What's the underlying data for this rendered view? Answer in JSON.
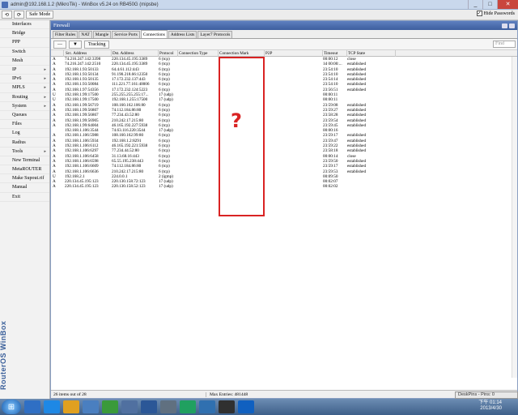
{
  "window": {
    "title": "admin@192.168.1.2 (MikroTik) - WinBox v5.24 on RB450G (mipsbe)",
    "min": "_",
    "max": "□",
    "close": "✕"
  },
  "toolbar": {
    "back": "⟲",
    "forward": "⟳",
    "safe_mode": "Safe Mode",
    "hide_passwords": "Hide Passwords",
    "hide_checked": "✓"
  },
  "sidebar": {
    "items": [
      {
        "label": "Interfaces",
        "arrow": ""
      },
      {
        "label": "Bridge",
        "arrow": ""
      },
      {
        "label": "PPP",
        "arrow": ""
      },
      {
        "label": "Switch",
        "arrow": ""
      },
      {
        "label": "Mesh",
        "arrow": ""
      },
      {
        "label": "IP",
        "arrow": "▸"
      },
      {
        "label": "IPv6",
        "arrow": "▸"
      },
      {
        "label": "MPLS",
        "arrow": "▸"
      },
      {
        "label": "Routing",
        "arrow": "▸"
      },
      {
        "label": "System",
        "arrow": "▸"
      },
      {
        "label": "Queues",
        "arrow": ""
      },
      {
        "label": "Files",
        "arrow": ""
      },
      {
        "label": "Log",
        "arrow": ""
      },
      {
        "label": "Radius",
        "arrow": ""
      },
      {
        "label": "Tools",
        "arrow": "▸"
      },
      {
        "label": "New Terminal",
        "arrow": ""
      },
      {
        "label": "MetaROUTER",
        "arrow": ""
      },
      {
        "label": "Make Supout.rif",
        "arrow": ""
      },
      {
        "label": "Manual",
        "arrow": ""
      },
      {
        "label": "Exit",
        "arrow": ""
      }
    ],
    "brand": "RouterOS WinBox"
  },
  "firewall": {
    "title": "Firewall",
    "tabs": [
      "Filter Rules",
      "NAT",
      "Mangle",
      "Service Ports",
      "Connections",
      "Address Lists",
      "Layer7 Protocols"
    ],
    "active_tab": 4,
    "minus": "—",
    "filter_icon": "▼",
    "tracking": "Tracking",
    "find_placeholder": "Find",
    "columns": [
      "",
      "Src. Address",
      "Dst. Address",
      "Protocol",
      "Connection Type",
      "Connection Mark",
      "P2P",
      "Timeout",
      "TCP State"
    ],
    "rows": [
      [
        "A",
        "74.216.247.142:3398",
        "220.134.45.195:3389",
        "6 (tcp)",
        "",
        "",
        "",
        "00:00:12",
        "close"
      ],
      [
        "A",
        "74.216.247.142:2510",
        "220.134.45.195:3389",
        "6 (tcp)",
        "",
        "",
        "",
        "1d 00:00:...",
        "established"
      ],
      [
        "A",
        "192.168.1.93:50133",
        "64.4.61.112:443",
        "6 (tcp)",
        "",
        "",
        "",
        "23:54:10",
        "established"
      ],
      [
        "A",
        "192.168.1.93:50134",
        "91.190.218.66:12350",
        "6 (tcp)",
        "",
        "",
        "",
        "23:54:10",
        "established"
      ],
      [
        "A",
        "192.168.1.93:50135",
        "17.172.232.137:443",
        "6 (tcp)",
        "",
        "",
        "",
        "23:54:14",
        "established"
      ],
      [
        "A",
        "192.168.1.93:50084",
        "111.221.77.161:40006",
        "6 (tcp)",
        "",
        "",
        "",
        "23:54:10",
        "established"
      ],
      [
        "A",
        "192.168.1.97:54356",
        "17.172.232.124:5223",
        "6 (tcp)",
        "",
        "",
        "",
        "23:56:51",
        "established"
      ],
      [
        "U",
        "192.168.1.99:17500",
        "255.255.255.255:17...",
        "17 (udp)",
        "",
        "",
        "",
        "00:00:11",
        ""
      ],
      [
        "U",
        "192.168.1.99:17500",
        "192.168.1.255:17500",
        "17 (udp)",
        "",
        "",
        "",
        "00:00:11",
        ""
      ],
      [
        "A",
        "192.168.1.99:56719",
        "108.160.162.106:80",
        "6 (tcp)",
        "",
        "",
        "",
        "23:59:08",
        "established"
      ],
      [
        "A",
        "192.168.1.99:56807",
        "74.112.184.86:80",
        "6 (tcp)",
        "",
        "",
        "",
        "23:59:27",
        "established"
      ],
      [
        "A",
        "192.168.1.99:56867",
        "77.234.43.52:80",
        "6 (tcp)",
        "",
        "",
        "",
        "23:58:28",
        "established"
      ],
      [
        "A",
        "192.168.1.99:56905",
        "210.242.17.215:80",
        "6 (tcp)",
        "",
        "",
        "",
        "23:59:54",
        "established"
      ],
      [
        "A",
        "192.168.1.99:64004",
        "46.165.192.227:5938",
        "6 (tcp)",
        "",
        "",
        "",
        "23:59:45",
        "established"
      ],
      [
        "",
        "192.168.1.106:3544",
        "74.63.116.220:3544",
        "17 (udp)",
        "",
        "",
        "",
        "00:00:16",
        ""
      ],
      [
        "A",
        "192.168.1.106:5988",
        "108.160.162.99:80",
        "6 (tcp)",
        "",
        "",
        "",
        "23:59:17",
        "established"
      ],
      [
        "A",
        "192.168.1.106:5934",
        "192.168.1.2:8291",
        "6 (tcp)",
        "",
        "",
        "",
        "23:59:47",
        "established"
      ],
      [
        "A",
        "192.168.1.106:6112",
        "46.165.192.221:5938",
        "6 (tcp)",
        "",
        "",
        "",
        "23:59:22",
        "established"
      ],
      [
        "A",
        "192.168.1.106:6297",
        "77.234.44.52:80",
        "6 (tcp)",
        "",
        "",
        "",
        "23:58:18",
        "established"
      ],
      [
        "A",
        "192.168.1.106:6458",
        "31.13.68.16:443",
        "6 (tcp)",
        "",
        "",
        "",
        "00:00:14",
        "close"
      ],
      [
        "A",
        "192.168.1.106:6598",
        "65.55.195.238:443",
        "6 (tcp)",
        "",
        "",
        "",
        "23:59:50",
        "established"
      ],
      [
        "A",
        "192.168.1.106:6609",
        "74.112.184.86:80",
        "6 (tcp)",
        "",
        "",
        "",
        "23:59:17",
        "established"
      ],
      [
        "A",
        "192.168.1.106:6636",
        "210.242.17.215:80",
        "6 (tcp)",
        "",
        "",
        "",
        "23:59:53",
        "established"
      ],
      [
        "U",
        "192.168.2.1",
        "224.0.0.1",
        "2 (igmp)",
        "",
        "",
        "",
        "00:09:50",
        ""
      ],
      [
        "A",
        "220.134.45.195:123",
        "220.130.158.72:123",
        "17 (udp)",
        "",
        "",
        "",
        "00:02:07",
        ""
      ],
      [
        "A",
        "220.134.45.195:123",
        "220.130.158.52:123",
        "17 (udp)",
        "",
        "",
        "",
        "00:02:02",
        ""
      ]
    ],
    "status_items": "26 items out of 28",
    "status_max": "Max Entries: 481448"
  },
  "annotation": {
    "question_mark": "?"
  },
  "taskbar": {
    "start": "⊞",
    "time": "下午 01:14",
    "date": "2013/4/30"
  },
  "deskpins": "DeskPins - Pins: 0",
  "colors": {
    "highlight_box": "#d92323",
    "title_blue": "#3e5f9e"
  }
}
